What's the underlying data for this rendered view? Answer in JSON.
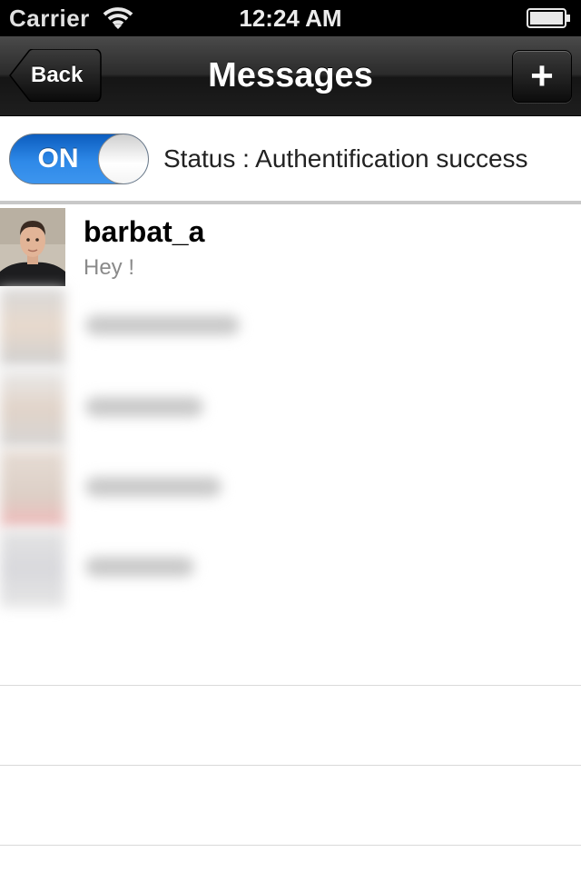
{
  "status_bar": {
    "carrier": "Carrier",
    "time": "12:24 AM",
    "wifi_icon": "wifi-icon",
    "battery_icon": "battery-icon"
  },
  "nav": {
    "title": "Messages",
    "back_label": "Back",
    "add_label": "+"
  },
  "connection": {
    "toggle_label": "ON",
    "toggle_on": true,
    "status_text": "Status : Authentification success",
    "accent_color": "#2e89e8"
  },
  "messages": [
    {
      "name": "barbat_a",
      "preview": "Hey !",
      "avatar": "user-photo"
    }
  ]
}
